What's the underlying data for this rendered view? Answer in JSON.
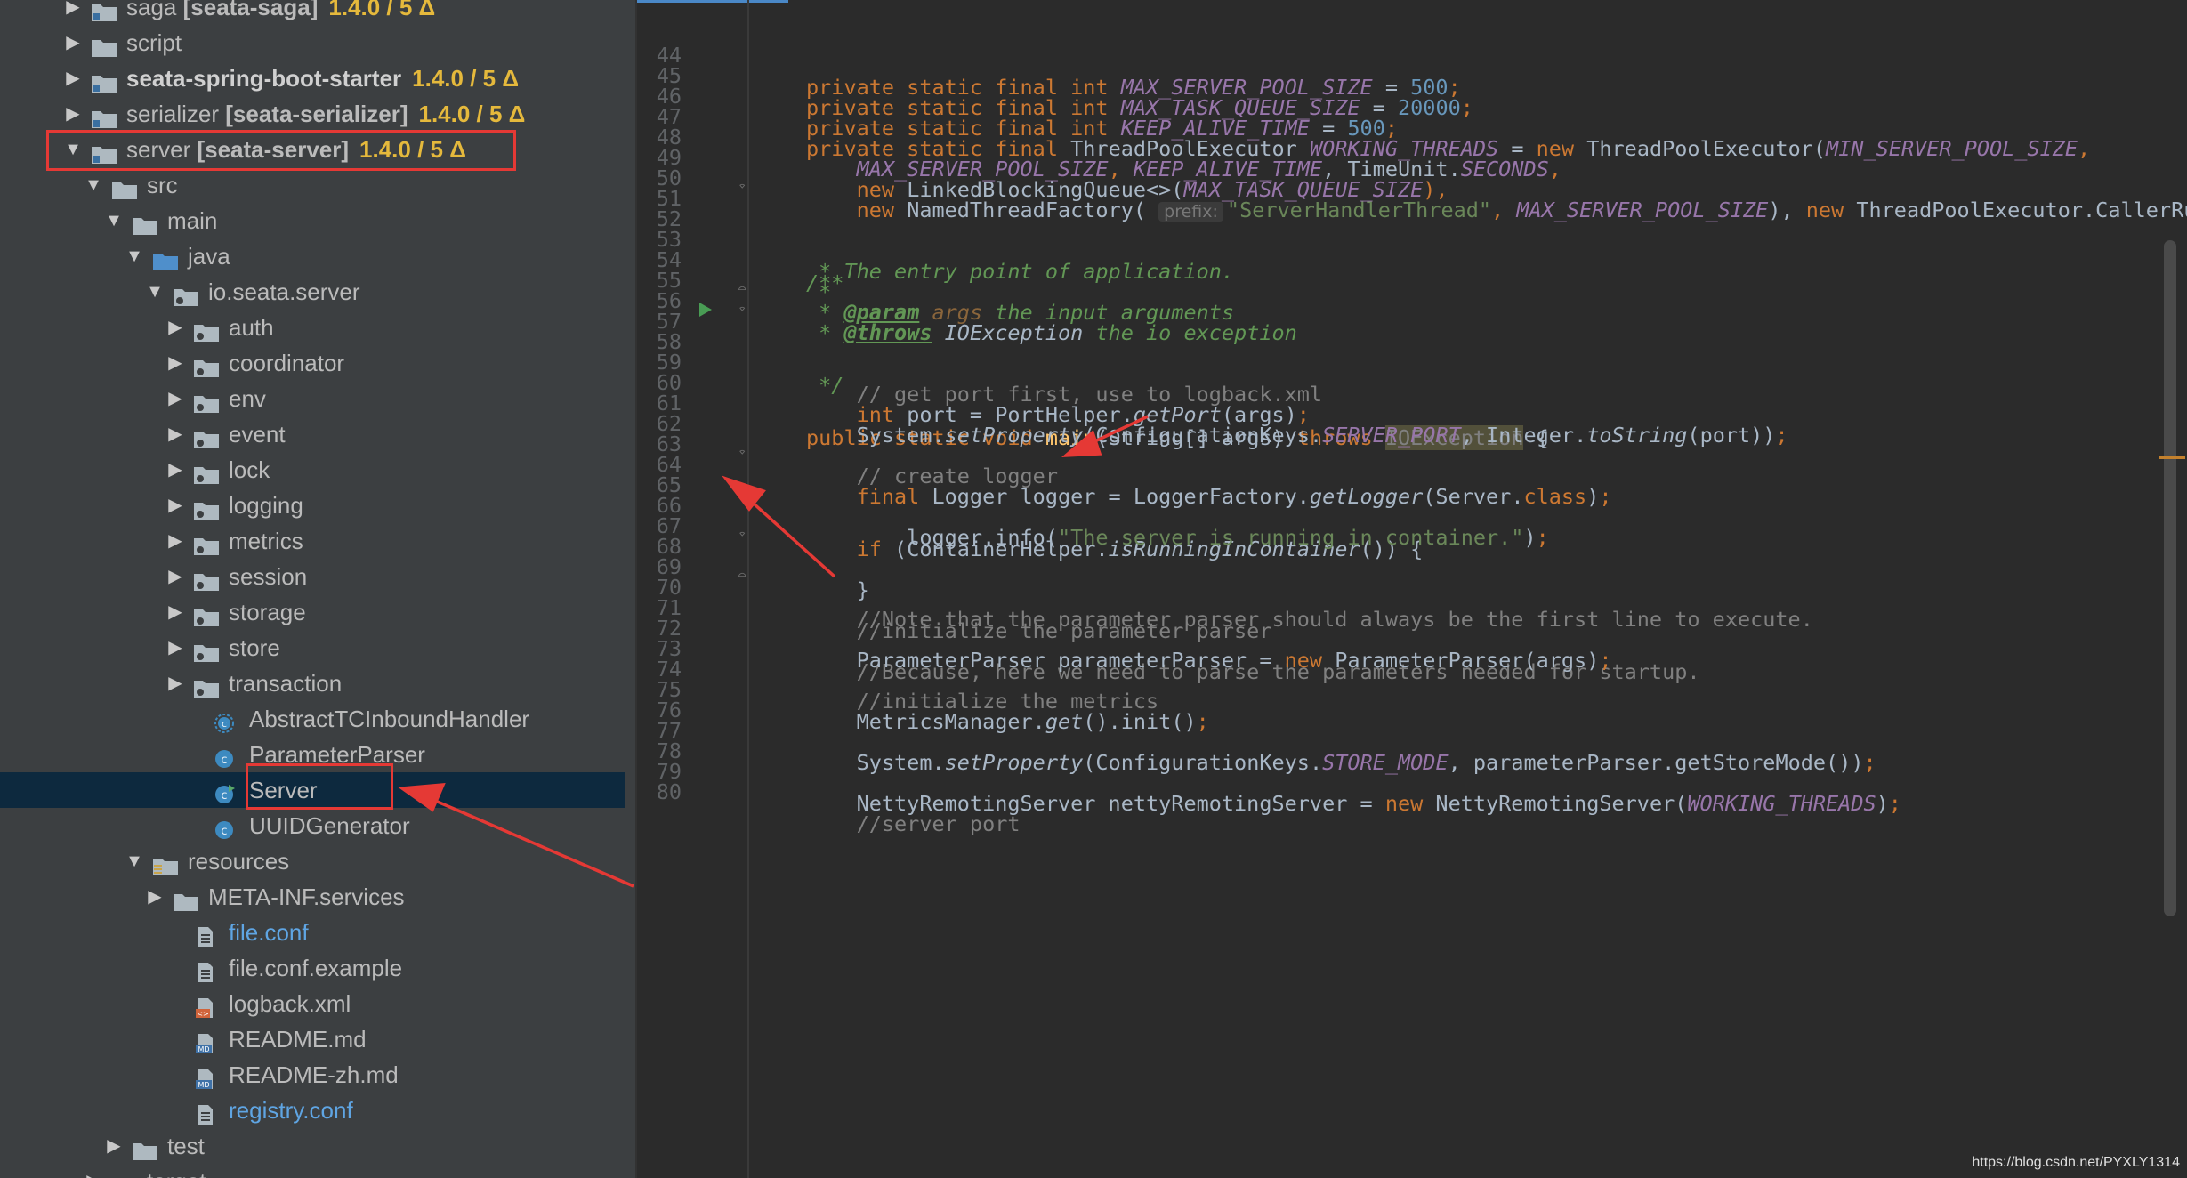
{
  "project_tree": {
    "rows": [
      {
        "label": "saga",
        "label_rest": " [seata-saga]",
        "version": "1.4.0 / 5 Δ",
        "icon": "module-folder-icon",
        "arrow": "▶",
        "bold": false
      },
      {
        "label": "script",
        "icon": "folder-icon",
        "arrow": "▶"
      },
      {
        "label": "seata-spring-boot-starter",
        "version": "1.4.0 / 5 Δ",
        "icon": "module-folder-icon",
        "arrow": "▶",
        "bold": true
      },
      {
        "label": "serializer",
        "label_rest": " [seata-serializer]",
        "version": "1.4.0 / 5 Δ",
        "icon": "module-folder-icon",
        "arrow": "▶"
      },
      {
        "label": "server",
        "label_rest": " [seata-server]",
        "version": "1.4.0 / 5 Δ",
        "icon": "module-folder-icon",
        "arrow": "▼"
      },
      {
        "label": "src",
        "icon": "folder-icon",
        "arrow": "▼"
      },
      {
        "label": "main",
        "icon": "folder-icon",
        "arrow": "▼"
      },
      {
        "label": "java",
        "icon": "source-folder-icon",
        "arrow": "▼"
      },
      {
        "label": "io.seata.server",
        "icon": "package-icon",
        "arrow": "▼"
      },
      {
        "label": "auth",
        "icon": "package-icon",
        "arrow": "▶"
      },
      {
        "label": "coordinator",
        "icon": "package-icon",
        "arrow": "▶"
      },
      {
        "label": "env",
        "icon": "package-icon",
        "arrow": "▶"
      },
      {
        "label": "event",
        "icon": "package-icon",
        "arrow": "▶"
      },
      {
        "label": "lock",
        "icon": "package-icon",
        "arrow": "▶"
      },
      {
        "label": "logging",
        "icon": "package-icon",
        "arrow": "▶"
      },
      {
        "label": "metrics",
        "icon": "package-icon",
        "arrow": "▶"
      },
      {
        "label": "session",
        "icon": "package-icon",
        "arrow": "▶"
      },
      {
        "label": "storage",
        "icon": "package-icon",
        "arrow": "▶"
      },
      {
        "label": "store",
        "icon": "package-icon",
        "arrow": "▶"
      },
      {
        "label": "transaction",
        "icon": "package-icon",
        "arrow": "▶"
      },
      {
        "label": "AbstractTCInboundHandler",
        "icon": "abstract-class-icon",
        "arrow": ""
      },
      {
        "label": "ParameterParser",
        "icon": "class-icon",
        "arrow": ""
      },
      {
        "label": "Server",
        "icon": "runnable-class-icon",
        "arrow": "",
        "selected": true
      },
      {
        "label": "UUIDGenerator",
        "icon": "class-icon",
        "arrow": ""
      },
      {
        "label": "resources",
        "icon": "resources-folder-icon",
        "arrow": "▼"
      },
      {
        "label": "META-INF.services",
        "icon": "folder-icon",
        "arrow": "▶"
      },
      {
        "label": "file.conf",
        "icon": "text-file-icon",
        "arrow": "",
        "blue": true
      },
      {
        "label": "file.conf.example",
        "icon": "text-file-icon",
        "arrow": ""
      },
      {
        "label": "logback.xml",
        "icon": "xml-file-icon",
        "arrow": ""
      },
      {
        "label": "README.md",
        "icon": "markdown-file-icon",
        "arrow": ""
      },
      {
        "label": "README-zh.md",
        "icon": "markdown-file-icon",
        "arrow": ""
      },
      {
        "label": "registry.conf",
        "icon": "text-file-icon",
        "arrow": "",
        "blue": true
      },
      {
        "label": "test",
        "icon": "folder-icon",
        "arrow": "▶"
      },
      {
        "label": "target",
        "icon": "excluded-folder-icon",
        "arrow": "▶"
      }
    ]
  },
  "editor": {
    "line_numbers": [
      "44",
      "45",
      "46",
      "47",
      "48",
      "49",
      "50",
      "51",
      "52",
      "53",
      "54",
      "55",
      "56",
      "57",
      "58",
      "59",
      "60",
      "61",
      "62",
      "63",
      "64",
      "65",
      "66",
      "67",
      "68",
      "69",
      "70",
      "71",
      "72",
      "73",
      "74",
      "75",
      "76",
      "77",
      "78",
      "79",
      "80"
    ],
    "code": {
      "l44": {
        "a": "private static final int ",
        "b": "MAX_SERVER_POOL_SIZE",
        "c": " = ",
        "d": "500",
        "e": ";"
      },
      "l45": {
        "a": "private static final int ",
        "b": "MAX_TASK_QUEUE_SIZE",
        "c": " = ",
        "d": "20000",
        "e": ";"
      },
      "l46": {
        "a": "private static final int ",
        "b": "KEEP_ALIVE_TIME",
        "c": " = ",
        "d": "500",
        "e": ";"
      },
      "l47": {
        "a": "private static final ",
        "b": "ThreadPoolExecutor ",
        "c": "WORKING_THREADS",
        "d": " = ",
        "e": "new ",
        "f": "ThreadPoolExecutor(",
        "g": "MIN_SERVER_POOL_SIZE",
        "h": ","
      },
      "l48": {
        "a": "    ",
        "b": "MAX_SERVER_POOL_SIZE",
        "c": ", ",
        "d": "KEEP_ALIVE_TIME",
        "e": ", TimeUnit.",
        "f": "SECONDS",
        "g": ","
      },
      "l49": {
        "a": "    ",
        "b": "new ",
        "c": "LinkedBlockingQueue<>(",
        "d": "MAX_TASK_QUEUE_SIZE",
        "e": "),"
      },
      "l50": {
        "a": "    ",
        "b": "new ",
        "c": "NamedThreadFactory( ",
        "hint": "prefix:",
        "d": "\"ServerHandlerThread\"",
        "e": ", ",
        "f": "MAX_SERVER_POOL_SIZE",
        "g": "), ",
        "h": "new ",
        "i": "ThreadPoolExecutor.CallerRunsPolicy());"
      },
      "l52": {
        "a": "/**"
      },
      "l53": {
        "a": " * The entry point of application."
      },
      "l54": {
        "a": " *"
      },
      "l55": {
        "a": " * ",
        "b": "@param",
        "c": " args",
        "d": " the input arguments"
      },
      "l56": {
        "a": " * ",
        "b": "@throws",
        "c": " IOException",
        "d": " the io exception"
      },
      "l57": {
        "a": " */"
      },
      "l58": {
        "a": "public static void ",
        "b": "main",
        "c": "(String[] args) ",
        "d": "throws ",
        "e": "IOException",
        "f": " {"
      },
      "l59": {
        "a": "    // get port first, use to logback.xml"
      },
      "l60": {
        "a": "    ",
        "b": "int ",
        "c": "port = PortHelper.",
        "d": "getPort",
        "e": "(args)",
        "f": ";"
      },
      "l61": {
        "a": "    System.",
        "b": "setProperty",
        "c": "(ConfigurationKeys.",
        "d": "SERVER_PORT",
        "e": ", Integer.",
        "f": "toString",
        "g": "(port))",
        "h": ";"
      },
      "l63": {
        "a": "    // create logger"
      },
      "l64": {
        "a": "    ",
        "b": "final ",
        "c": "Logger logger = LoggerFactory.",
        "d": "getLogger",
        "e": "(Server.",
        "f": "class",
        "g": ")",
        "h": ";"
      },
      "l65": {
        "a": "    ",
        "b": "if ",
        "c": "(ContainerHelper.",
        "d": "isRunningInContainer",
        "e": "()) {"
      },
      "l66": {
        "a": "        logger.info(",
        "b": "\"The server is running in container.\"",
        "c": ")",
        "d": ";"
      },
      "l67": {
        "a": "    }"
      },
      "l69": {
        "a": "    //initialize the parameter parser"
      },
      "l70": {
        "a": "    //Note that the parameter parser should always be the first line to execute."
      },
      "l71": {
        "a": "    //Because, here we need to parse the parameters needed for startup."
      },
      "l72": {
        "a": "    ParameterParser parameterParser = ",
        "b": "new ",
        "c": "ParameterParser(args)",
        "d": ";"
      },
      "l74": {
        "a": "    //initialize the metrics"
      },
      "l75": {
        "a": "    MetricsManager.",
        "b": "get",
        "c": "().init()",
        "d": ";"
      },
      "l77": {
        "a": "    System.",
        "b": "setProperty",
        "c": "(ConfigurationKeys.",
        "d": "STORE_MODE",
        "e": ", parameterParser.getStoreMode())",
        "f": ";"
      },
      "l79": {
        "a": "    NettyRemotingServer nettyRemotingServer = ",
        "b": "new ",
        "c": "NettyRemotingServer(",
        "d": "WORKING_THREADS",
        "e": ")",
        "f": ";"
      },
      "l80": {
        "a": "    //server port"
      }
    }
  },
  "watermark": "https://blog.csdn.net/PYXLY1314",
  "colors": {
    "annotation_red": "#e53935",
    "tree_bg": "#3c3f41",
    "editor_bg": "#2b2b2b",
    "selection": "#0d293e",
    "version": "#e5b93c"
  }
}
